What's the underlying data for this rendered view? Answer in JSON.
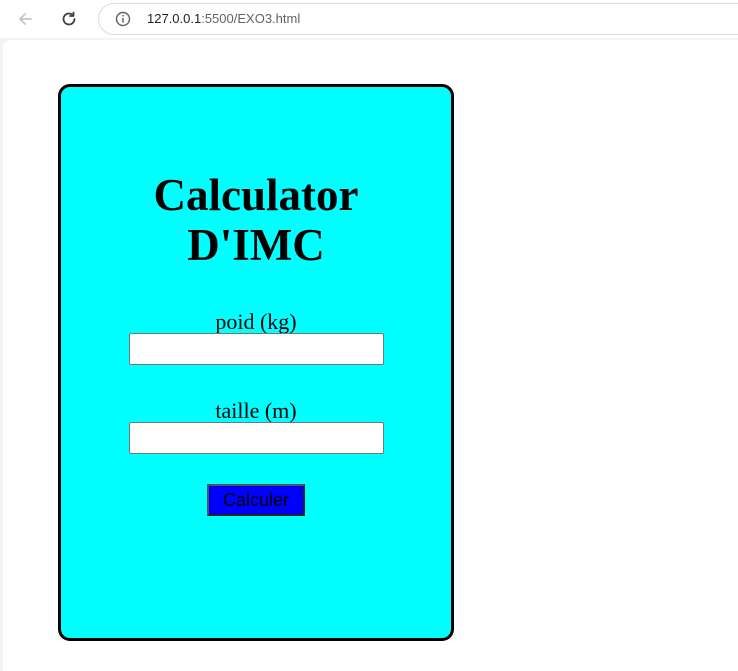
{
  "browser": {
    "url_host": "127.0.0.1",
    "url_rest": ":5500/EXO3.html",
    "back_icon": "arrow-left-icon",
    "reload_icon": "reload-icon",
    "info_icon": "info-icon"
  },
  "card": {
    "title_line1": "Calculator",
    "title_line2": "D'IMC",
    "weight_label": "poid (kg)",
    "weight_value": "",
    "height_label": "taille (m)",
    "height_value": "",
    "button_label": "Calculer",
    "background_color": "#00ffff",
    "button_color": "#0000ff"
  }
}
